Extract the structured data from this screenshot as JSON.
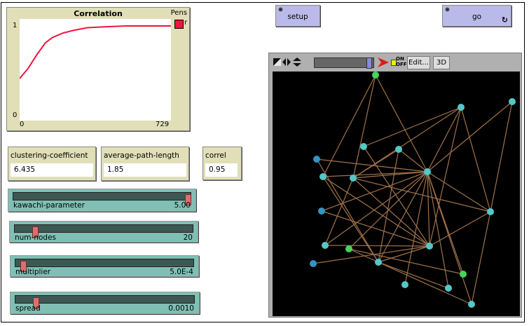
{
  "buttons": {
    "setup": "setup",
    "go": "go",
    "go_forever_icon": "loop-icon"
  },
  "plot": {
    "title": "Correlation",
    "pens_label": "Pens",
    "pen_name": "r",
    "pen_color": "#f0143c",
    "chart_data": {
      "type": "line",
      "title": "Correlation",
      "xlim": [
        0,
        729
      ],
      "ylim": [
        0,
        1
      ],
      "x_ticks": [
        "0",
        "729"
      ],
      "y_ticks": [
        "0",
        "1"
      ],
      "series": [
        {
          "name": "r",
          "color": "#f0143c",
          "x": [
            0,
            40,
            81,
            124,
            158,
            208,
            259,
            326,
            410,
            511,
            729
          ],
          "y": [
            0.41,
            0.52,
            0.67,
            0.81,
            0.87,
            0.92,
            0.95,
            0.98,
            0.99,
            1.0,
            1.0
          ]
        }
      ]
    }
  },
  "monitors": [
    {
      "label": "clustering-coefficient",
      "value": "6.435"
    },
    {
      "label": "average-path-length",
      "value": "1.85"
    },
    {
      "label": "correl",
      "value": "0.95"
    }
  ],
  "sliders": [
    {
      "name": "kawachi-parameter",
      "value": "5.00",
      "fraction": 1.0
    },
    {
      "name": "num-nodes",
      "value": "20",
      "fraction": 0.1
    },
    {
      "name": "multiplier",
      "value": "5.0E-4",
      "fraction": 0.03
    },
    {
      "name": "spread",
      "value": "0.0010",
      "fraction": 0.1
    }
  ],
  "view": {
    "edit_label": "Edit...",
    "three_d_label": "3D",
    "speed_fraction": 0.95,
    "update_toggle": "ON OFF"
  },
  "network": {
    "node_colors": {
      "cyan": "#52c8c8",
      "blue": "#3494c4",
      "green": "#44d65a"
    },
    "link_color": "#a0724a"
  }
}
